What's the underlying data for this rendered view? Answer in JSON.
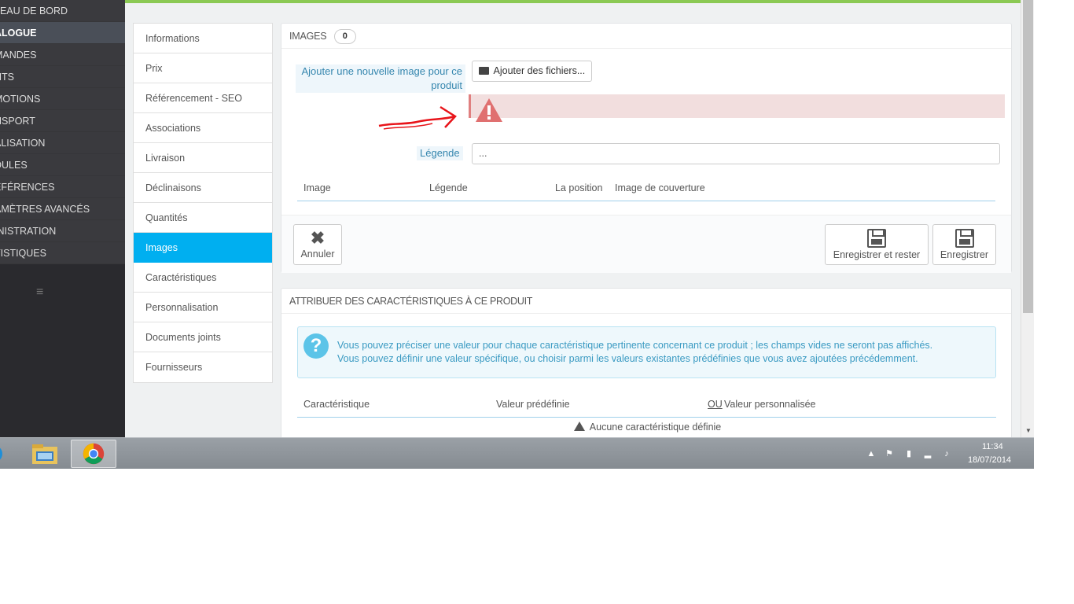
{
  "admin_nav": {
    "items": [
      {
        "label": "LEAU DE BORD",
        "active": false
      },
      {
        "label": "ALOGUE",
        "active": true
      },
      {
        "label": "MANDES",
        "active": false
      },
      {
        "label": "NTS",
        "active": false
      },
      {
        "label": "MOTIONS",
        "active": false
      },
      {
        "label": "NSPORT",
        "active": false
      },
      {
        "label": "ALISATION",
        "active": false
      },
      {
        "label": "DULES",
        "active": false
      },
      {
        "label": "ÉFÉRENCES",
        "active": false
      },
      {
        "label": "AMÈTRES AVANCÉS",
        "active": false
      },
      {
        "label": "INISTRATION",
        "active": false
      },
      {
        "label": "TISTIQUES",
        "active": false
      }
    ],
    "collapse_icon": "≡"
  },
  "product_tabs": [
    {
      "label": "Informations",
      "active": false
    },
    {
      "label": "Prix",
      "active": false
    },
    {
      "label": "Référencement - SEO",
      "active": false
    },
    {
      "label": "Associations",
      "active": false
    },
    {
      "label": "Livraison",
      "active": false
    },
    {
      "label": "Déclinaisons",
      "active": false
    },
    {
      "label": "Quantités",
      "active": false
    },
    {
      "label": "Images",
      "active": true
    },
    {
      "label": "Caractéristiques",
      "active": false
    },
    {
      "label": "Personnalisation",
      "active": false
    },
    {
      "label": "Documents joints",
      "active": false
    },
    {
      "label": "Fournisseurs",
      "active": false
    }
  ],
  "images_panel": {
    "title": "IMAGES",
    "count": "0",
    "add_image_label": "Ajouter une nouvelle image pour ce produit",
    "add_files_button": "Ajouter des fichiers...",
    "legend_label": "Légende",
    "legend_value": "...",
    "table_headers": [
      "Image",
      "Légende",
      "La position",
      "Image de couverture"
    ],
    "cancel_button": "Annuler",
    "save_stay_button": "Enregistrer et rester",
    "save_button": "Enregistrer"
  },
  "features_panel": {
    "title": "ATTRIBUER DES CARACTÉRISTIQUES À CE PRODUIT",
    "info_line1": "Vous pouvez préciser une valeur pour chaque caractéristique pertinente concernant ce produit ; les champs vides ne seront pas affichés.",
    "info_line2": "Vous pouvez définir une valeur spécifique, ou choisir parmi les valeurs existantes prédéfinies que vous avez ajoutées précédemment.",
    "col_feature": "Caractéristique",
    "col_predefined": "Valeur prédéfinie",
    "col_or": "OU",
    "col_custom": "Valeur personnalisée",
    "empty_message": "Aucune caractéristique définie"
  },
  "taskbar": {
    "time": "11:34",
    "date": "18/07/2014"
  },
  "colors": {
    "accent": "#00aff0",
    "top_bar": "#8bc954",
    "error_bg": "#f2dede",
    "annotation_arrow": "#e8141a"
  }
}
